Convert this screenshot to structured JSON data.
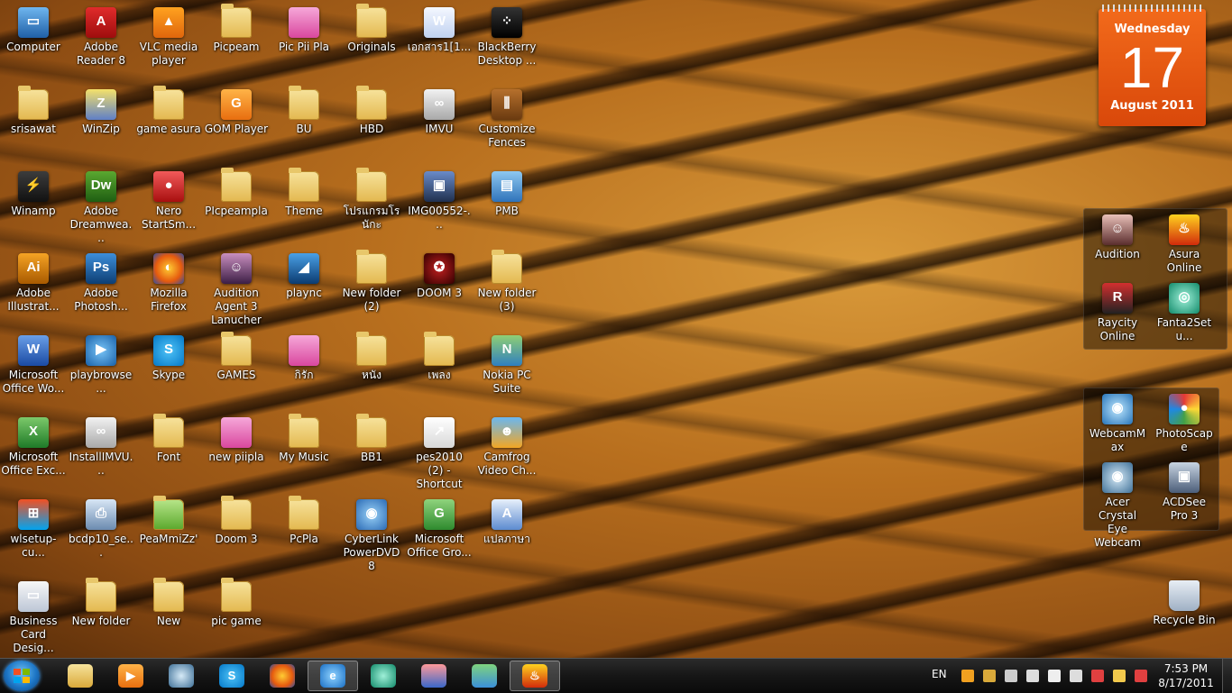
{
  "desktop_icons": [
    {
      "label": "Computer",
      "icon": "computer-icon"
    },
    {
      "label": "Adobe Reader 8",
      "icon": "adobe-reader-icon"
    },
    {
      "label": "VLC media player",
      "icon": "vlc-icon"
    },
    {
      "label": "Picpeam",
      "icon": "folder-icon"
    },
    {
      "label": "Pic Pii Pla",
      "icon": "pink-file-icon"
    },
    {
      "label": "Originals",
      "icon": "folder-icon"
    },
    {
      "label": "เอกสาร1[1...",
      "icon": "word-document-icon"
    },
    {
      "label": "BlackBerry Desktop ...",
      "icon": "blackberry-icon"
    },
    {
      "label": "srisawat",
      "icon": "folder-icon"
    },
    {
      "label": "WinZip",
      "icon": "winzip-icon"
    },
    {
      "label": "game asura",
      "icon": "folder-icon"
    },
    {
      "label": "GOM Player",
      "icon": "gom-player-icon"
    },
    {
      "label": "BU",
      "icon": "folder-icon"
    },
    {
      "label": "HBD",
      "icon": "folder-icon"
    },
    {
      "label": "IMVU",
      "icon": "imvu-icon"
    },
    {
      "label": "Customize Fences",
      "icon": "fences-icon"
    },
    {
      "label": "Winamp",
      "icon": "winamp-icon"
    },
    {
      "label": "Adobe Dreamwea...",
      "icon": "dreamweaver-icon"
    },
    {
      "label": "Nero StartSm...",
      "icon": "nero-icon"
    },
    {
      "label": "PIcpeampla",
      "icon": "folder-icon"
    },
    {
      "label": "Theme",
      "icon": "folder-icon"
    },
    {
      "label": "โปรแกรมโรนักะ",
      "icon": "folder-icon"
    },
    {
      "label": "IMG00552-...",
      "icon": "image-icon"
    },
    {
      "label": "PMB",
      "icon": "pmb-icon"
    },
    {
      "label": "Adobe Illustrat...",
      "icon": "illustrator-icon"
    },
    {
      "label": "Adobe Photosh...",
      "icon": "photoshop-icon"
    },
    {
      "label": "Mozilla Firefox",
      "icon": "firefox-icon"
    },
    {
      "label": "Audition Agent 3 Lanucher",
      "icon": "audition-agent-icon"
    },
    {
      "label": "plaync",
      "icon": "plaync-icon"
    },
    {
      "label": "New folder (2)",
      "icon": "folder-icon"
    },
    {
      "label": "DOOM 3",
      "icon": "doom-icon"
    },
    {
      "label": "New folder (3)",
      "icon": "folder-icon"
    },
    {
      "label": "Microsoft Office Wo...",
      "icon": "word-icon"
    },
    {
      "label": "playbrowse...",
      "icon": "play-icon"
    },
    {
      "label": "Skype",
      "icon": "skype-icon"
    },
    {
      "label": "GAMES",
      "icon": "folder-icon"
    },
    {
      "label": "กิรัก",
      "icon": "pink-file-icon"
    },
    {
      "label": "หนัง",
      "icon": "folder-icon"
    },
    {
      "label": "เพลง",
      "icon": "folder-icon"
    },
    {
      "label": "Nokia PC Suite",
      "icon": "nokia-icon"
    },
    {
      "label": "Microsoft Office Exc...",
      "icon": "excel-icon"
    },
    {
      "label": "InstallIMVU...",
      "icon": "imvu-icon"
    },
    {
      "label": "Font",
      "icon": "folder-icon"
    },
    {
      "label": "new piipla",
      "icon": "pink-file-icon"
    },
    {
      "label": "My Music",
      "icon": "folder-icon"
    },
    {
      "label": "BB1",
      "icon": "folder-icon"
    },
    {
      "label": "pes2010 (2) - Shortcut",
      "icon": "shortcut-icon"
    },
    {
      "label": "Camfrog Video Ch...",
      "icon": "camfrog-icon"
    },
    {
      "label": "wlsetup-cu...",
      "icon": "windows-live-icon"
    },
    {
      "label": "bcdp10_se...",
      "icon": "setup-icon"
    },
    {
      "label": "PeaMmiZz'",
      "icon": "green-folder-icon"
    },
    {
      "label": "Doom 3",
      "icon": "folder-icon"
    },
    {
      "label": "PcPla",
      "icon": "folder-icon"
    },
    {
      "label": "CyberLink PowerDVD 8",
      "icon": "powerdvd-icon"
    },
    {
      "label": "Microsoft Office Gro...",
      "icon": "groove-icon"
    },
    {
      "label": "แปลภาษา",
      "icon": "translate-icon"
    },
    {
      "label": "Business Card Desig...",
      "icon": "business-card-icon"
    },
    {
      "label": "New folder",
      "icon": "folder-icon"
    },
    {
      "label": "New",
      "icon": "folder-icon"
    },
    {
      "label": "pic game",
      "icon": "folder-icon"
    }
  ],
  "fences": [
    {
      "items": [
        {
          "label": "Audition",
          "icon": "audition-icon"
        },
        {
          "label": "Asura Online",
          "icon": "asura-icon"
        },
        {
          "label": "Raycity Online",
          "icon": "raycity-icon"
        },
        {
          "label": "Fanta2Setu...",
          "icon": "fanta-icon"
        }
      ]
    },
    {
      "items": [
        {
          "label": "WebcamMax",
          "icon": "webcammax-icon"
        },
        {
          "label": "PhotoScape",
          "icon": "photoscape-icon"
        },
        {
          "label": "Acer Crystal Eye Webcam",
          "icon": "webcam-icon"
        },
        {
          "label": "ACDSee Pro 3",
          "icon": "acdsee-icon"
        }
      ]
    }
  ],
  "recycle_bin": {
    "label": "Recycle Bin",
    "icon": "recycle-bin-icon"
  },
  "calendar": {
    "day": "Wednesday",
    "date": "17",
    "month": "August 2011"
  },
  "taskbar": {
    "pinned": [
      {
        "icon": "explorer-folder-icon"
      },
      {
        "icon": "media-player-icon"
      },
      {
        "icon": "webcam-icon"
      },
      {
        "icon": "skype-icon"
      },
      {
        "icon": "firefox-icon"
      },
      {
        "icon": "internet-explorer-icon",
        "active": true
      },
      {
        "icon": "app-green-icon"
      },
      {
        "icon": "game-icon"
      },
      {
        "icon": "messenger-icon"
      },
      {
        "icon": "asura-icon",
        "active": true
      }
    ],
    "language": "EN",
    "time": "7:53 PM",
    "date": "8/17/2011"
  },
  "colors": {
    "calendar_orange": "#e85a12",
    "taskbar": "#151515",
    "wallpaper_base": "#c07a25"
  }
}
